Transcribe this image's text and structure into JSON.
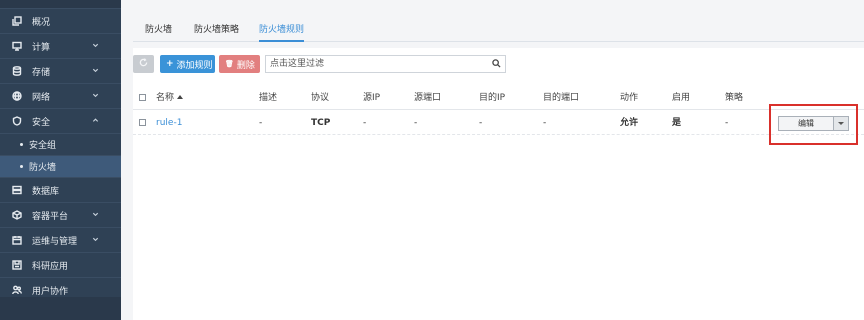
{
  "sidebar": {
    "items": [
      {
        "label": "概况",
        "icon": "copy-icon",
        "has_children": false
      },
      {
        "label": "计算",
        "icon": "monitor-icon",
        "has_children": true
      },
      {
        "label": "存储",
        "icon": "database-icon",
        "has_children": true
      },
      {
        "label": "网络",
        "icon": "globe-icon",
        "has_children": true
      },
      {
        "label": "安全",
        "icon": "shield-icon",
        "has_children": true,
        "expanded": true
      },
      {
        "label": "数据库",
        "icon": "server-icon",
        "has_children": false
      },
      {
        "label": "容器平台",
        "icon": "cube-icon",
        "has_children": true
      },
      {
        "label": "运维与管理",
        "icon": "calendar-icon",
        "has_children": true
      },
      {
        "label": "科研应用",
        "icon": "disk-icon",
        "has_children": false
      },
      {
        "label": "用户协作",
        "icon": "users-icon",
        "has_children": false
      }
    ],
    "security_children": [
      {
        "label": "安全组",
        "active": false
      },
      {
        "label": "防火墙",
        "active": true
      }
    ]
  },
  "tabs": [
    {
      "label": "防火墙",
      "active": false
    },
    {
      "label": "防火墙策略",
      "active": false
    },
    {
      "label": "防火墙规则",
      "active": true
    }
  ],
  "toolbar": {
    "add_label": "添加规则",
    "add_glyph": "+",
    "delete_label": "删除",
    "delete_glyph": "🗑",
    "search_placeholder": "点击这里过滤",
    "search_value": ""
  },
  "table": {
    "columns": [
      "名称",
      "描述",
      "协议",
      "源IP",
      "源端口",
      "目的IP",
      "目的端口",
      "动作",
      "启用",
      "策略"
    ],
    "rows": [
      {
        "name": "rule-1",
        "description": "-",
        "protocol": "TCP",
        "source_ip": "-",
        "source_port": "-",
        "dest_ip": "-",
        "dest_port": "-",
        "action": "允许",
        "enabled": "是",
        "policy": "-",
        "row_action": "编辑"
      }
    ]
  },
  "colors": {
    "sidebar_bg": "#2f4155",
    "sidebar_active": "#3e5a7a",
    "accent": "#3b8ed6",
    "add_button": "#3a93d8",
    "delete_button": "#e27f7f",
    "highlight_box": "#d9302b"
  }
}
